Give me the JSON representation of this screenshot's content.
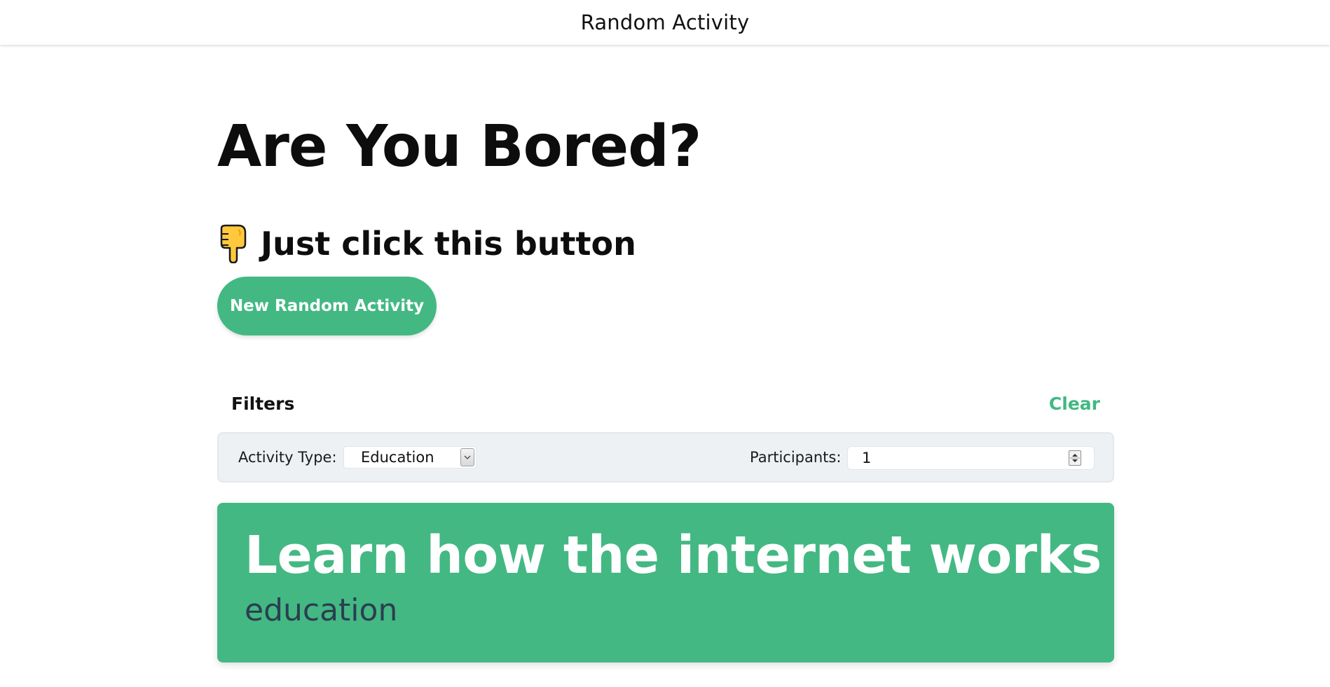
{
  "app": {
    "title": "Random Activity"
  },
  "hero": {
    "heading": "Are You Bored?",
    "subheading": "Just click this button",
    "pointer_icon": "backhand-index-pointing-down-icon",
    "button_label": "New Random Activity"
  },
  "filters": {
    "title": "Filters",
    "clear_label": "Clear",
    "type_label": "Activity Type:",
    "type_value": "Education",
    "participants_label": "Participants:",
    "participants_value": "1"
  },
  "activity": {
    "title": "Learn how the internet works",
    "type": "education"
  },
  "colors": {
    "accent": "#43b883",
    "filter_bg": "#edf1f4",
    "activity_type_text": "#2c3e50"
  }
}
